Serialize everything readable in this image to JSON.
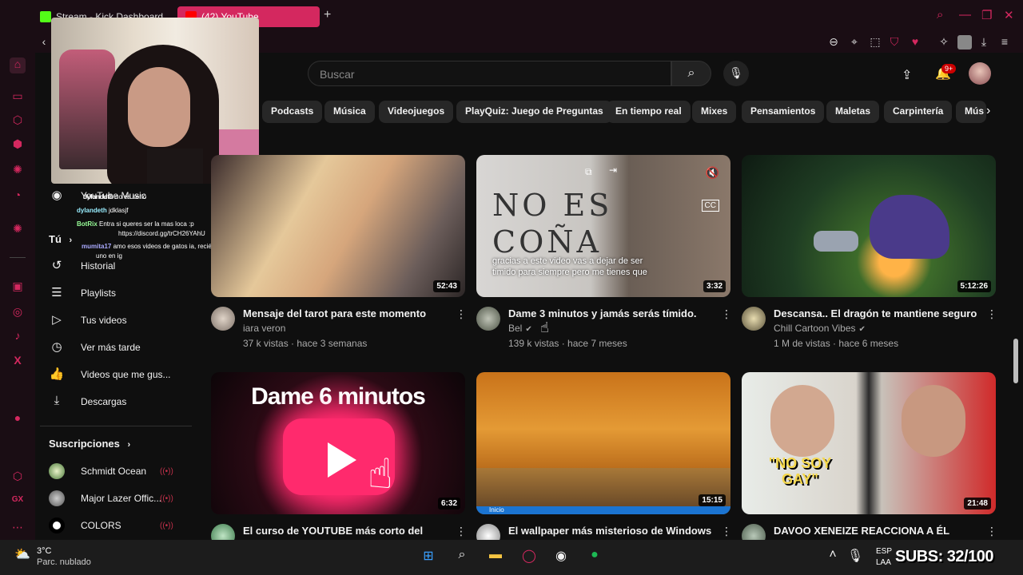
{
  "browser": {
    "tabs": [
      {
        "label": "Stream - Kick Dashboard"
      },
      {
        "label": "(42) YouTube"
      }
    ],
    "add_tab": "+"
  },
  "header": {
    "search_placeholder": "Buscar",
    "notification_count": "9+"
  },
  "chips": [
    "Podcasts",
    "Música",
    "Videojuegos",
    "PlayQuiz: Juego de Preguntas",
    "En tiempo real",
    "Mixes",
    "Pensamientos",
    "Maletas",
    "Carpintería",
    "Mús"
  ],
  "sidebar": {
    "you_label": "Tú",
    "items": [
      {
        "label": "Historial",
        "icon": "history-icon"
      },
      {
        "label": "Playlists",
        "icon": "playlists-icon"
      },
      {
        "label": "Tus videos",
        "icon": "your-videos-icon"
      },
      {
        "label": "Ver más tarde",
        "icon": "watch-later-icon"
      },
      {
        "label": "Videos que me gus...",
        "icon": "liked-videos-icon"
      },
      {
        "label": "Descargas",
        "icon": "downloads-icon"
      }
    ],
    "youtube_music": "YouTube Music",
    "subscriptions_label": "Suscripciones",
    "subscriptions": [
      {
        "name": "Schmidt Ocean"
      },
      {
        "name": "Major Lazer Offic..."
      },
      {
        "name": "COLORS"
      }
    ]
  },
  "chat": [
    {
      "user": "dylandeth",
      "text": "no es serio"
    },
    {
      "user": "dylandeth",
      "text": "jdklasjf"
    },
    {
      "user": "BotRix",
      "text": "Entra si queres ser la mas loca :p"
    },
    {
      "user": "",
      "text": "https://discord.gg/trCH26YAhU"
    },
    {
      "user": "mumita17",
      "text": "amo esos videos de gatos ia, recién me apareció"
    },
    {
      "user": "",
      "text": "uno en ig"
    }
  ],
  "videos": [
    {
      "title": "Mensaje del tarot para este momento",
      "channel": "iara veron",
      "verified": false,
      "meta": "37 k vistas · hace 3 semanas",
      "duration": "52:43"
    },
    {
      "title": "Dame 3 minutos y jamás serás tímido.",
      "channel": "Bel",
      "verified": true,
      "meta": "139 k vistas · hace 7 meses",
      "duration": "3:32",
      "overlay_text": "NO ES\nCOÑA",
      "caption": "gracias a este video vas a dejar de ser timido para siempre pero me tienes que"
    },
    {
      "title": "Descansa.. El dragón te mantiene seguro",
      "channel": "Chill Cartoon Vibes",
      "verified": true,
      "meta": "1 M de vistas · hace 6 meses",
      "duration": "5:12:26"
    },
    {
      "title": "El curso de YOUTUBE más corto del",
      "channel": "",
      "verified": false,
      "meta": "",
      "duration": "6:32",
      "overlay_text": "Dame 6 minutos"
    },
    {
      "title": "El wallpaper más misterioso de Windows",
      "channel": "",
      "verified": false,
      "meta": "",
      "duration": "15:15",
      "bar_text": "Inicio"
    },
    {
      "title": "DAVOO XENEIZE REACCIONA A ÉL",
      "channel": "",
      "verified": false,
      "meta": "",
      "duration": "21:48",
      "overlay_text": "\"NO SOY GAY\""
    }
  ],
  "taskbar": {
    "weather_temp": "3°C",
    "weather_desc": "Parc. nublado",
    "lang": "ESP\nLAA",
    "subs_overlay": "SUBS: 32/100"
  },
  "colors": {
    "opera_accent": "#d4285f",
    "yt_bg": "#0f0f0f",
    "chip_bg": "#272727"
  }
}
